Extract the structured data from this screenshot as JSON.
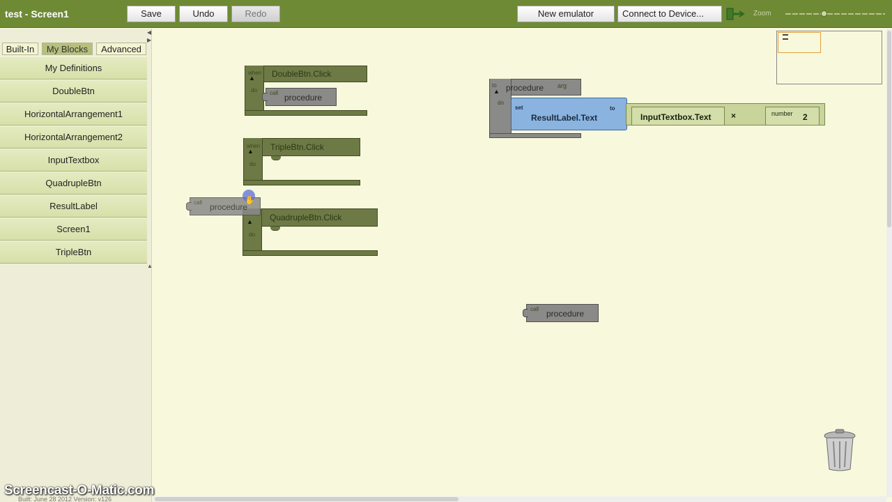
{
  "toolbar": {
    "title": "test - Screen1",
    "save_label": "Save",
    "undo_label": "Undo",
    "redo_label": "Redo",
    "new_emulator_label": "New emulator",
    "connect_label": "Connect to Device...",
    "zoom_label": "Zoom"
  },
  "tabs": [
    "Built-In",
    "My Blocks",
    "Advanced"
  ],
  "drawer_items": [
    "My Definitions",
    "DoubleBtn",
    "HorizontalArrangement1",
    "HorizontalArrangement2",
    "InputTextbox",
    "QuadrupleBtn",
    "ResultLabel",
    "Screen1",
    "TripleBtn"
  ],
  "blocks": {
    "double_click": "DoubleBtn.Click",
    "triple_click": "TripleBtn.Click",
    "quadruple_click": "QuadrupleBtn.Click",
    "proc_label": "procedure",
    "do_label": "do",
    "arg_label": "arg",
    "set_label": "set",
    "to_label": "to",
    "result_text": "ResultLabel.Text",
    "input_text": "InputTextbox.Text",
    "times_symbol": "×",
    "number_label": "number",
    "number_value": "2"
  },
  "watermark": "Screencast-O-Matic.com",
  "build_info": "Built: June 28 2012 Version: v126"
}
